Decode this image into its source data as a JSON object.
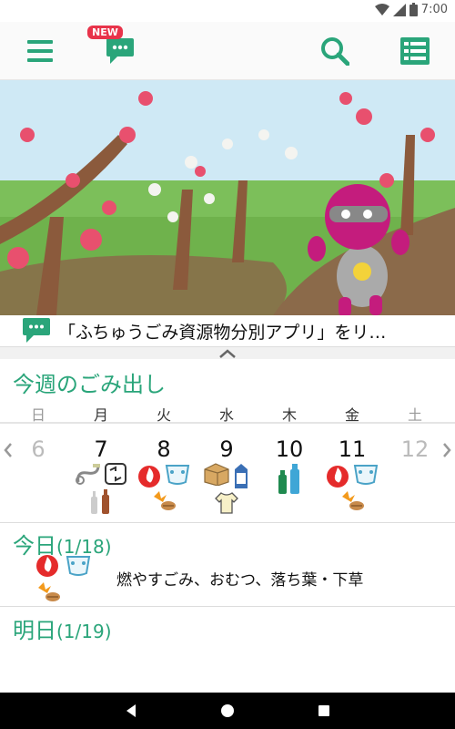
{
  "status_bar": {
    "time": "7:00"
  },
  "app_bar": {
    "new_badge": "NEW",
    "icons": [
      "menu-icon",
      "chat-bubble-icon",
      "search-icon",
      "list-icon"
    ]
  },
  "news": {
    "text": "「ふちゅうごみ資源物分別アプリ」をリ…"
  },
  "week": {
    "title": "今週のごみ出し",
    "day_names": [
      "日",
      "月",
      "火",
      "水",
      "木",
      "金",
      "土"
    ],
    "days": [
      {
        "num": "6",
        "dim": true,
        "icons": []
      },
      {
        "num": "7",
        "dim": false,
        "icons": [
          "hose-icon",
          "recycle-plastic-icon",
          "bottle-icon"
        ]
      },
      {
        "num": "8",
        "dim": false,
        "icons": [
          "burnable-flame-icon",
          "diaper-icon",
          "leaves-icon"
        ]
      },
      {
        "num": "9",
        "dim": false,
        "icons": [
          "cardboard-box-icon",
          "milk-carton-icon",
          "clothes-icon"
        ]
      },
      {
        "num": "10",
        "dim": false,
        "icons": [
          "pet-bottle-icon"
        ]
      },
      {
        "num": "11",
        "dim": false,
        "icons": [
          "burnable-flame-icon",
          "diaper-icon",
          "leaves-icon"
        ]
      },
      {
        "num": "12",
        "dim": true,
        "icons": []
      }
    ]
  },
  "today": {
    "label": "今日",
    "date": "(1/18)",
    "types": "燃やすごみ、おむつ、落ち葉・下草",
    "icons": [
      "burnable-flame-icon",
      "diaper-icon",
      "leaves-icon"
    ]
  },
  "tomorrow": {
    "label": "明日",
    "date": "(1/19)"
  },
  "colors": {
    "accent": "#2aa57a",
    "badge": "#e8334a",
    "nav_bar": "#000000"
  }
}
